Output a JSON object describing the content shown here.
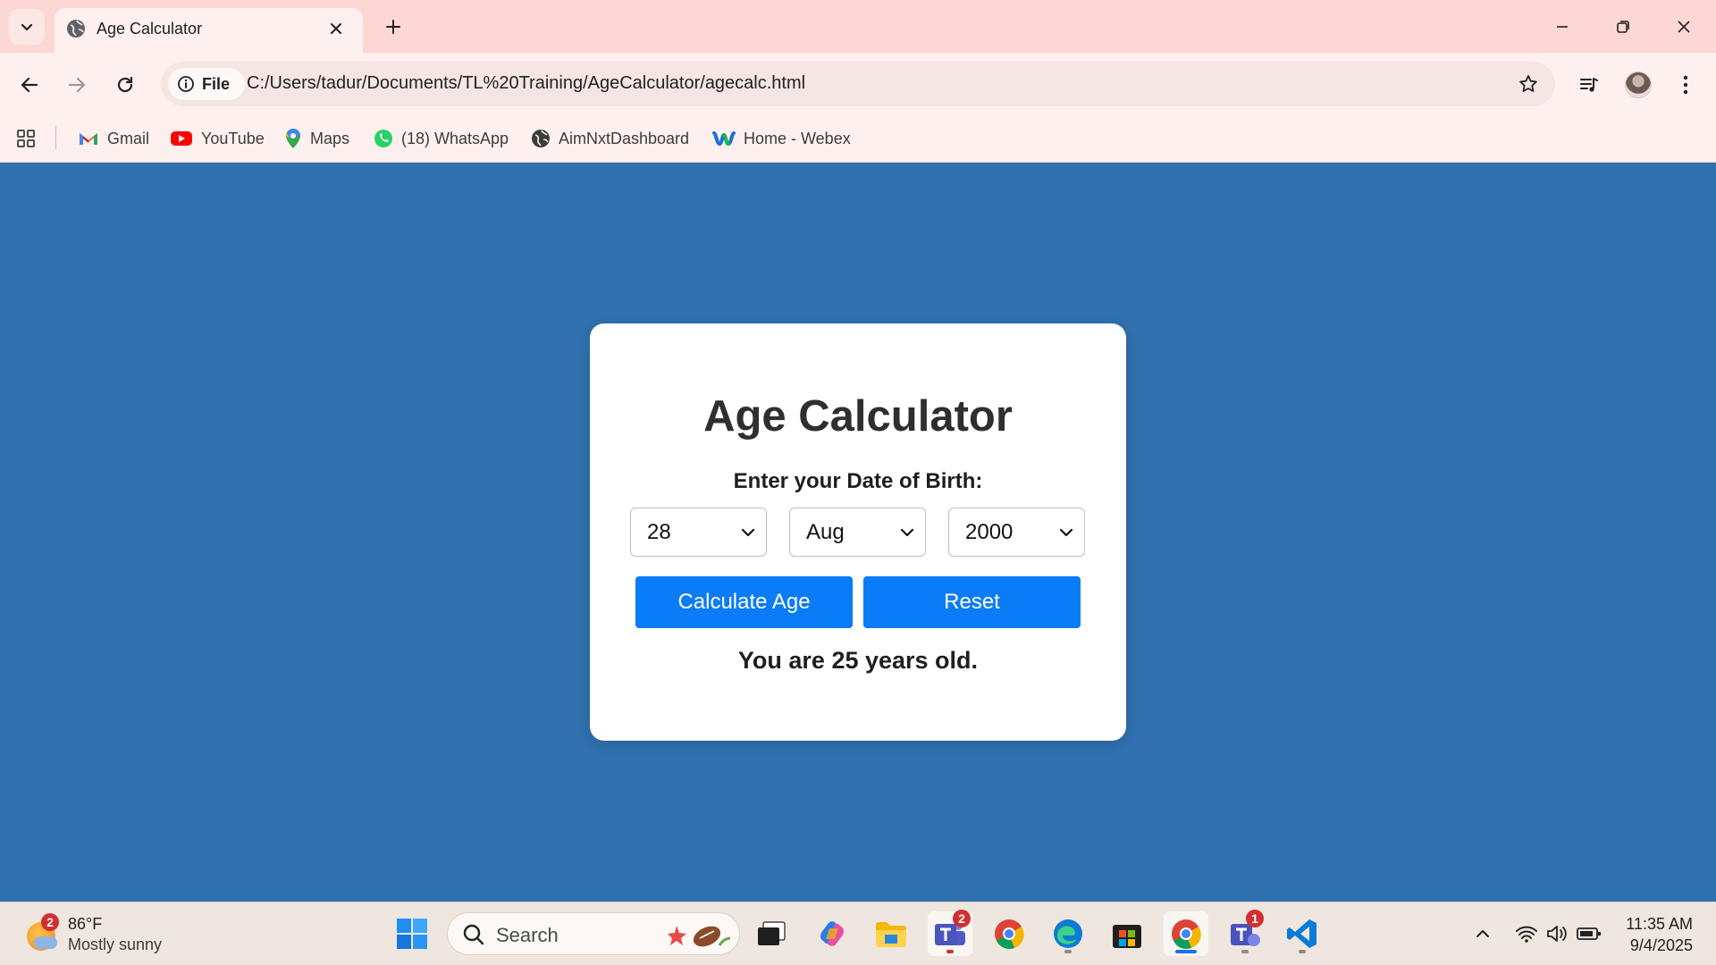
{
  "browser": {
    "tab_title": "Age Calculator",
    "address_chip": "File",
    "url": "C:/Users/tadur/Documents/TL%20Training/AgeCalculator/agecalc.html",
    "bookmarks": [
      "Gmail",
      "YouTube",
      "Maps",
      "(18) WhatsApp",
      "AimNxtDashboard",
      "Home - Webex"
    ]
  },
  "page": {
    "heading": "Age Calculator",
    "prompt": "Enter your Date of Birth:",
    "day": "28",
    "month": "Aug",
    "year": "2000",
    "calculate_label": "Calculate Age",
    "reset_label": "Reset",
    "result": "You are 25 years old."
  },
  "taskbar": {
    "weather_badge": "2",
    "temperature": "86°F",
    "weather": "Mostly sunny",
    "search_placeholder": "Search",
    "teams_badge": "2",
    "teams2_badge": "1",
    "time": "11:35 AM",
    "date": "9/4/2025"
  },
  "colors": {
    "page_bg": "#3070ae",
    "button": "#0a7cf7",
    "tabstrip": "#fdd7d3"
  }
}
